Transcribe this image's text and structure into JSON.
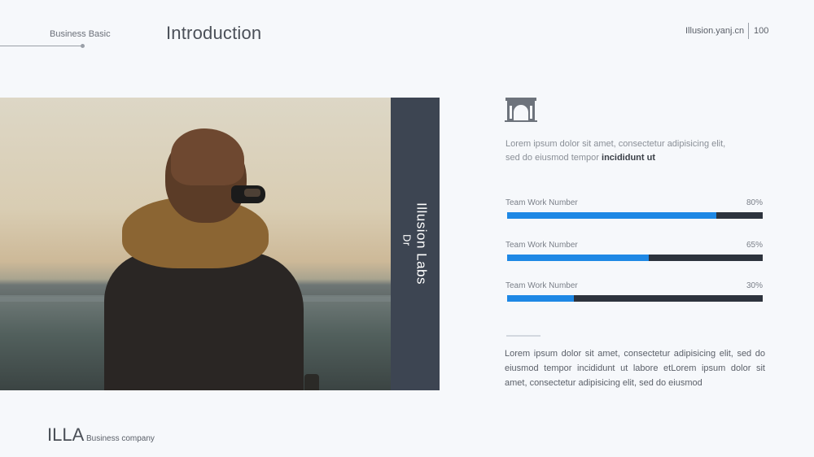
{
  "header": {
    "section_label": "Business Basic",
    "title": "Introduction",
    "site": "Illusion.yanj.cn",
    "page_number": "100"
  },
  "photo_panel": {
    "vertical_prefix": "Dr",
    "vertical_title": "Illusion Labs"
  },
  "icons": {
    "arch": "arch-gate-icon"
  },
  "intro": {
    "text_plain": "Lorem ipsum dolor sit amet, consectetur adipisicing elit, sed do eiusmod tempor ",
    "text_bold": "incididunt ut"
  },
  "progress": [
    {
      "label": "Team Work Number",
      "value_text": "80%",
      "value": 0.82
    },
    {
      "label": "Team Work Number",
      "value_text": "65%",
      "value": 0.555
    },
    {
      "label": "Team Work Number",
      "value_text": "30%",
      "value": 0.26
    }
  ],
  "colors": {
    "accent": "#1e88e5",
    "track": "#2d333d",
    "panel": "#3d4552"
  },
  "body_text": "Lorem ipsum dolor sit amet, consectetur adipisicing elit, sed do eiusmod tempor incididunt ut labore etLorem ipsum dolor sit amet, consectetur adipisicing elit, sed do eiusmod",
  "footer": {
    "brand": "ILLA",
    "tagline": "Business company"
  }
}
